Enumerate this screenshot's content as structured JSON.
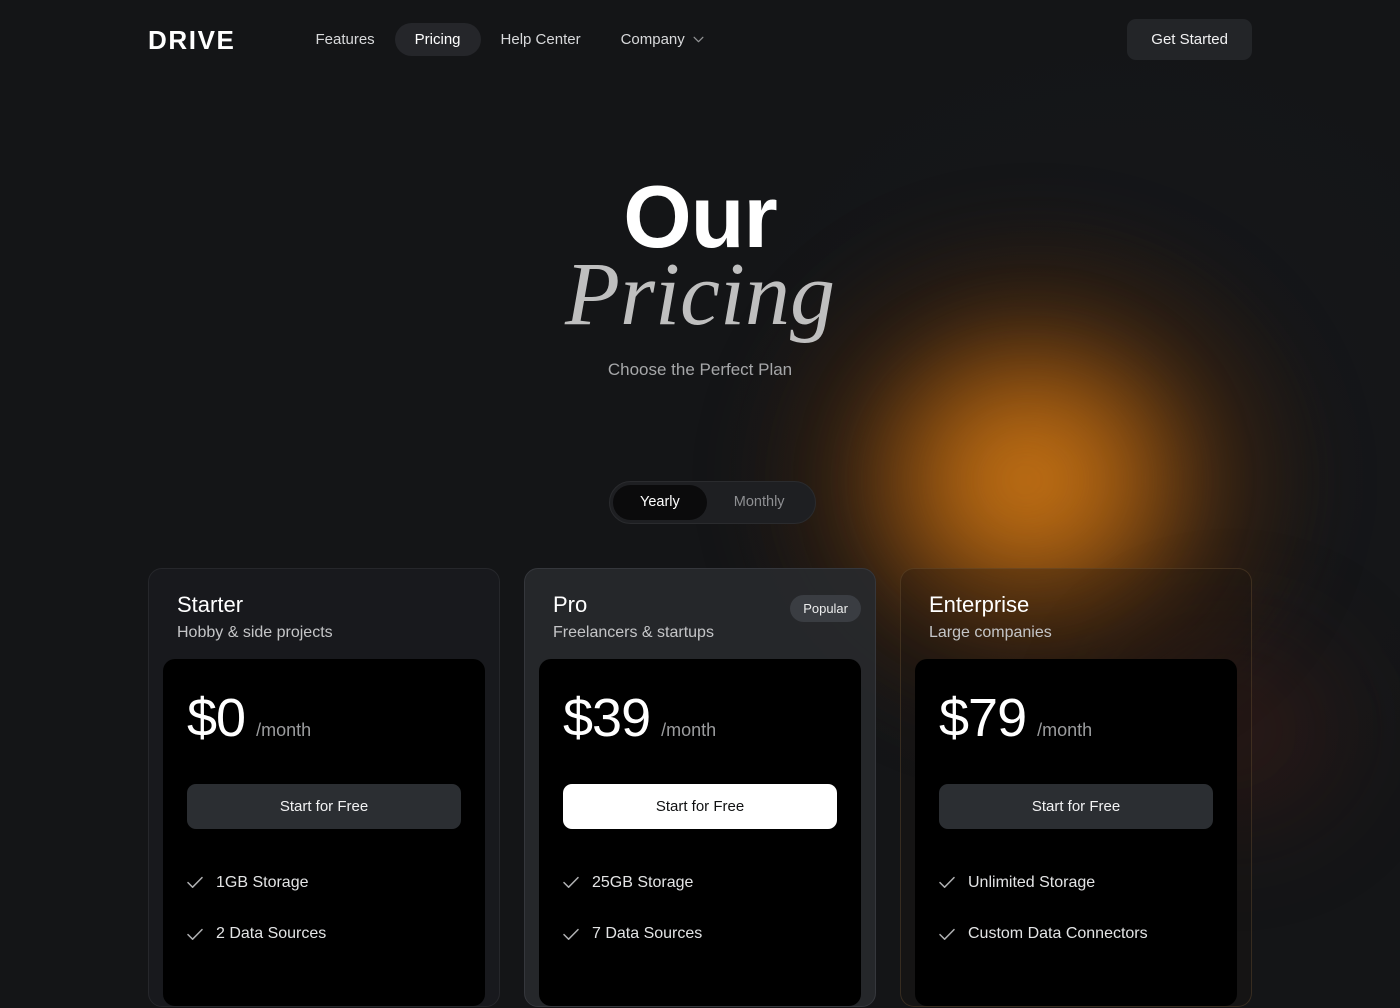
{
  "nav": {
    "logo": "DRIVE",
    "links": [
      {
        "label": "Features",
        "active": false,
        "caret": false
      },
      {
        "label": "Pricing",
        "active": true,
        "caret": false
      },
      {
        "label": "Help Center",
        "active": false,
        "caret": false
      },
      {
        "label": "Company",
        "active": false,
        "caret": true
      }
    ],
    "cta_label": "Get Started"
  },
  "hero": {
    "title_line1": "Our",
    "title_line2": "Pricing",
    "subtitle": "Choose the Perfect Plan"
  },
  "billing_toggle": {
    "options": [
      {
        "label": "Yearly",
        "active": true
      },
      {
        "label": "Monthly",
        "active": false
      }
    ],
    "selected": "Yearly"
  },
  "plans": [
    {
      "name": "Starter",
      "tagline": "Hobby & side projects",
      "badge": null,
      "price": "$0",
      "period": "/month",
      "cta_label": "Start for Free",
      "cta_style": "dark",
      "features": [
        "1GB Storage",
        "2 Data Sources"
      ]
    },
    {
      "name": "Pro",
      "tagline": "Freelancers & startups",
      "badge": "Popular",
      "price": "$39",
      "period": "/month",
      "cta_label": "Start for Free",
      "cta_style": "light",
      "features": [
        "25GB Storage",
        "7 Data Sources"
      ]
    },
    {
      "name": "Enterprise",
      "tagline": "Large companies",
      "badge": null,
      "price": "$79",
      "period": "/month",
      "cta_label": "Start for Free",
      "cta_style": "dark",
      "features": [
        "Unlimited Storage",
        "Custom Data Connectors"
      ]
    }
  ],
  "colors": {
    "background": "#141517",
    "accent_glow": "#c47012",
    "card_starter_bg": "#1a1b1e",
    "card_pro_bg": "#27292d",
    "inner_panel_bg": "#000000",
    "cta_dark": "#2b2e32",
    "cta_light": "#ffffff",
    "text_primary": "#ffffff",
    "text_muted": "#9b9c9e",
    "serif_heading": "#bfbfbf"
  },
  "icons": {
    "chevron_down": "chevron-down-icon",
    "check": "check-icon"
  }
}
